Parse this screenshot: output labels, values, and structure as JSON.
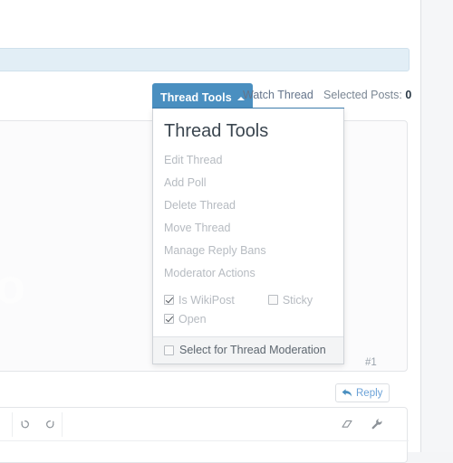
{
  "page": {
    "watermark_text": "ro"
  },
  "tabs": {
    "thread_tools_label": "Thread Tools",
    "thread_tools_caret": "caret-up-icon",
    "watch_thread_label": "Watch Thread",
    "selected_posts_label": "Selected Posts:",
    "selected_posts_count": "0",
    "active_tab_color": "#4a8fc0"
  },
  "post": {
    "index_label": "#1",
    "reply_label": "Reply",
    "reply_icon": "reply-arrow-icon"
  },
  "menu": {
    "title": "Thread Tools",
    "items": [
      {
        "label": "Edit Thread"
      },
      {
        "label": "Add Poll"
      },
      {
        "label": "Delete Thread"
      },
      {
        "label": "Move Thread"
      },
      {
        "label": "Manage Reply Bans"
      },
      {
        "label": "Moderator Actions"
      }
    ],
    "checkboxes": [
      {
        "label": "Is WikiPost",
        "checked": true
      },
      {
        "label": "Sticky",
        "checked": false
      },
      {
        "label": "Open",
        "checked": true
      }
    ],
    "footer": {
      "label": "Select for Thread Moderation",
      "checked": false
    }
  },
  "editor": {
    "buttons": [
      {
        "name": "undo",
        "label": "Undo"
      },
      {
        "name": "redo",
        "label": "Redo"
      },
      {
        "name": "eraser",
        "label": "Remove formatting"
      },
      {
        "name": "wrench",
        "label": "Options"
      }
    ]
  }
}
